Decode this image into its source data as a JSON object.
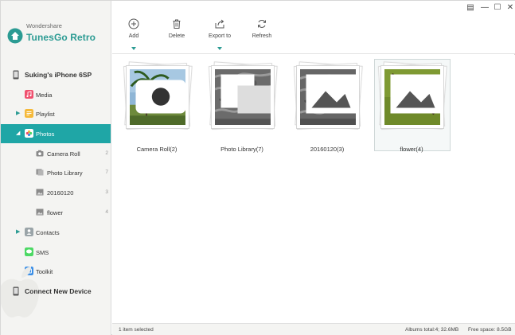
{
  "app": {
    "brand_small": "Wondershare",
    "brand_name": "TunesGo Retro"
  },
  "window_controls": [
    "feedback-icon",
    "minimize-icon",
    "maximize-icon",
    "close-icon"
  ],
  "toolbar": {
    "add_label": "Add",
    "delete_label": "Delete",
    "export_label": "Export to",
    "refresh_label": "Refresh"
  },
  "sidebar": {
    "device_name": "Suking's iPhone 6SP",
    "items": [
      {
        "label": "Media",
        "icon": "music-icon",
        "color": "#f0506e"
      },
      {
        "label": "Playlist",
        "icon": "playlist-icon",
        "color": "#f5b93a"
      },
      {
        "label": "Photos",
        "icon": "photos-icon",
        "color": "#f28a2e"
      },
      {
        "label": "Contacts",
        "icon": "contacts-icon",
        "color": "#9aa4a8"
      },
      {
        "label": "SMS",
        "icon": "sms-icon",
        "color": "#4cd964"
      },
      {
        "label": "Toolkit",
        "icon": "toolkit-icon",
        "color": "#3a8ee6"
      }
    ],
    "albums": [
      {
        "label": "Camera Roll",
        "count": "2"
      },
      {
        "label": "Photo Library",
        "count": "7"
      },
      {
        "label": "20160120",
        "count": "3"
      },
      {
        "label": "flower",
        "count": "4"
      }
    ],
    "connect_label": "Connect New Device"
  },
  "content": {
    "albums": [
      {
        "name": "Camera Roll(2)",
        "badge": "camera-icon"
      },
      {
        "name": "Photo Library(7)",
        "badge": "library-icon"
      },
      {
        "name": "20160120(3)",
        "badge": "image-icon"
      },
      {
        "name": "flower(4)",
        "badge": "image-icon"
      }
    ]
  },
  "status": {
    "selection": "1 item selected",
    "albums_total": "Albums total:4; 32.6MB",
    "free_space": "Free space: 8.5GB"
  },
  "colors": {
    "accent": "#1fa6a6",
    "brand": "#2b9b93"
  }
}
